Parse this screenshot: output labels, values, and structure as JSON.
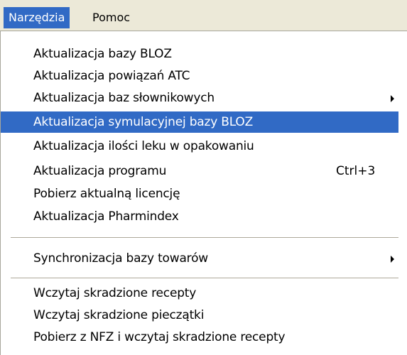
{
  "menubar": {
    "items": [
      {
        "label": "Narzędzia",
        "active": true
      },
      {
        "label": "Pomoc",
        "active": false
      }
    ]
  },
  "menu": {
    "items": [
      {
        "label": "Aktualizacja bazy BLOZ"
      },
      {
        "label": "Aktualizacja powiązań ATC"
      },
      {
        "label": "Aktualizacja baz słownikowych",
        "submenu_icon": "chevron-right-icon"
      },
      {
        "label": "Aktualizacja symulacyjnej bazy BLOZ",
        "highlighted": true
      },
      {
        "label": "Aktualizacja ilości leku w opakowaniu"
      },
      {
        "label": "Aktualizacja programu",
        "shortcut": "Ctrl+3"
      },
      {
        "label": "Pobierz aktualną licencję"
      },
      {
        "label": "Aktualizacja Pharmindex"
      },
      {
        "label": "Synchronizacja bazy towarów",
        "submenu_icon": "chevron-right-icon"
      },
      {
        "label": "Wczytaj skradzione recepty"
      },
      {
        "label": "Wczytaj skradzione pieczątki"
      },
      {
        "label": "Pobierz z NFZ i wczytaj skradzione recepty"
      }
    ]
  },
  "colors": {
    "menubar_background": "#ece9d8",
    "highlight": "#316ac5",
    "highlight_text": "#ffffff",
    "separator": "#aca899"
  }
}
